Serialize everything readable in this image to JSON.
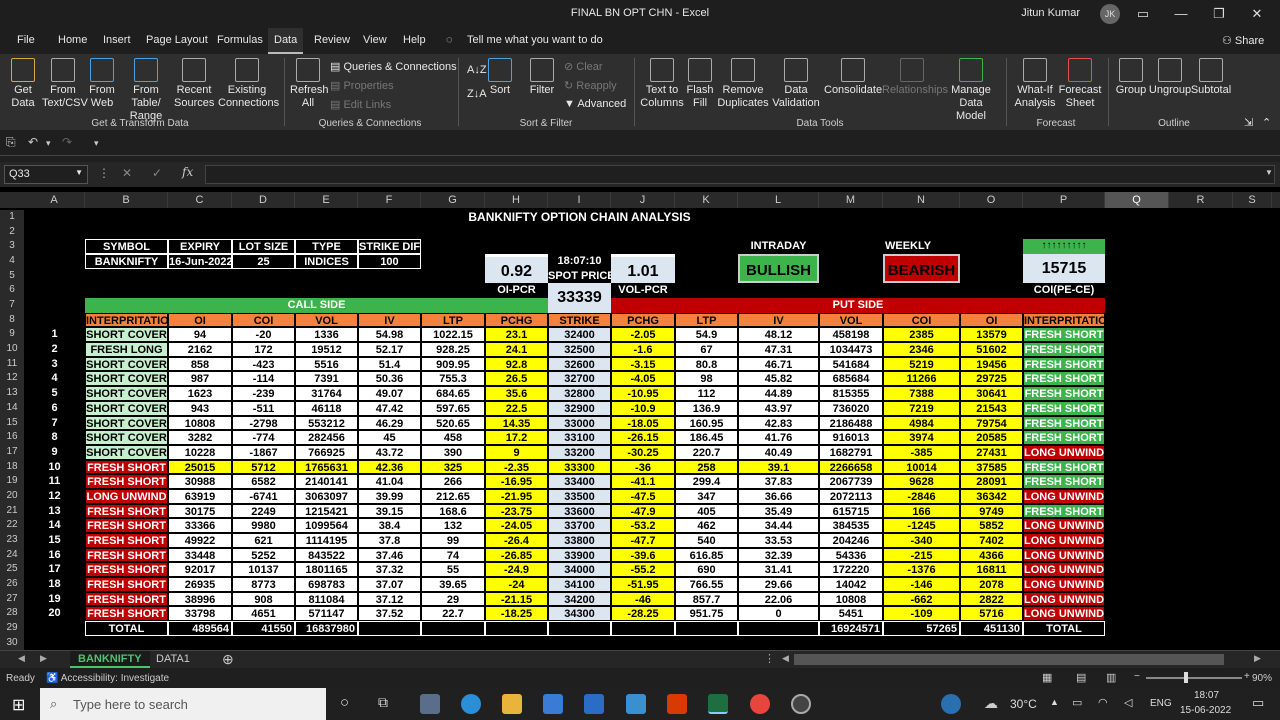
{
  "window": {
    "title": "FINAL BN OPT CHN  -  Excel",
    "user": "Jitun Kumar",
    "avatar": "JK"
  },
  "menu": [
    "File",
    "Home",
    "Insert",
    "Page Layout",
    "Formulas",
    "Data",
    "Review",
    "View",
    "Help"
  ],
  "menu_active": "Data",
  "tell_me": "Tell me what you want to do",
  "share": "Share",
  "ribbon": {
    "get_data": "Get Data",
    "from_text": "From Text/CSV",
    "from_web": "From Web",
    "from_table": "From Table/ Range",
    "recent_sources": "Recent Sources",
    "existing_connections": "Existing Connections",
    "group_get_transform": "Get & Transform Data",
    "refresh_all": "Refresh All",
    "queries_connections": "Queries & Connections",
    "properties": "Properties",
    "edit_links": "Edit Links",
    "group_queries": "Queries & Connections",
    "sort": "Sort",
    "filter": "Filter",
    "clear": "Clear",
    "reapply": "Reapply",
    "advanced": "Advanced",
    "group_sort_filter": "Sort & Filter",
    "text_to_columns": "Text to Columns",
    "flash_fill": "Flash Fill",
    "remove_duplicates": "Remove Duplicates",
    "data_validation": "Data Validation",
    "consolidate": "Consolidate",
    "relationships": "Relationships",
    "manage_data_model": "Manage Data Model",
    "group_data_tools": "Data Tools",
    "what_if": "What-If Analysis",
    "forecast_sheet": "Forecast Sheet",
    "group_forecast": "Forecast",
    "group_btn": "Group",
    "ungroup": "Ungroup",
    "subtotal": "Subtotal",
    "group_outline": "Outline"
  },
  "name_box": "Q33",
  "columns": [
    "A",
    "B",
    "C",
    "D",
    "E",
    "F",
    "G",
    "H",
    "I",
    "J",
    "K",
    "L",
    "M",
    "N",
    "O",
    "P",
    "Q",
    "R",
    "S"
  ],
  "selected_col": "Q",
  "rows": [
    "1",
    "2",
    "3",
    "4",
    "5",
    "6",
    "7",
    "8",
    "9",
    "10",
    "11",
    "12",
    "13",
    "14",
    "15",
    "16",
    "17",
    "18",
    "19",
    "20",
    "21",
    "22",
    "23",
    "24",
    "25",
    "26",
    "27",
    "28",
    "29",
    "30"
  ],
  "sheet": {
    "title": "BANKNIFTY OPTION CHAIN ANALYSIS",
    "info_headers": [
      "SYMBOL",
      "EXPIRY",
      "LOT SIZE",
      "TYPE",
      "STRIKE DIF"
    ],
    "info_values": [
      "BANKNIFTY",
      "16-Jun-2022",
      "25",
      "INDICES",
      "100"
    ],
    "oi_pcr_value": "0.92",
    "oi_pcr_label": "OI-PCR",
    "time": "18:07:10",
    "spot_label": "SPOT PRICE",
    "spot_value": "33339",
    "vol_pcr_value": "1.01",
    "vol_pcr_label": "VOL-PCR",
    "intraday_label": "INTRADAY",
    "intraday_value": "BULLISH",
    "weekly_label": "WEEKLY",
    "weekly_value": "BEARISH",
    "coi_arrows": "↑↑↑↑↑↑↑↑↑",
    "coi_value": "15715",
    "coi_label": "COI(PE-CE)",
    "call_side": "CALL SIDE",
    "put_side": "PUT SIDE",
    "headers": [
      "INTERPRITATION",
      "OI",
      "COI",
      "VOL",
      "IV",
      "LTP",
      "PCHG",
      "STRIKE",
      "PCHG",
      "LTP",
      "IV",
      "VOL",
      "COI",
      "OI",
      "INTERPRITATION"
    ],
    "data": [
      [
        "1",
        "SHORT COVER",
        "94",
        "-20",
        "1336",
        "54.98",
        "1022.15",
        "23.1",
        "32400",
        "-2.05",
        "54.9",
        "48.12",
        "458198",
        "2385",
        "13579",
        "FRESH SHORT"
      ],
      [
        "2",
        "FRESH LONG",
        "2162",
        "172",
        "19512",
        "52.17",
        "928.25",
        "24.1",
        "32500",
        "-1.6",
        "67",
        "47.31",
        "1034473",
        "2346",
        "51602",
        "FRESH SHORT"
      ],
      [
        "3",
        "SHORT COVER",
        "858",
        "-423",
        "5516",
        "51.4",
        "909.95",
        "92.8",
        "32600",
        "-3.15",
        "80.8",
        "46.71",
        "541684",
        "5219",
        "19456",
        "FRESH SHORT"
      ],
      [
        "4",
        "SHORT COVER",
        "987",
        "-114",
        "7391",
        "50.36",
        "755.3",
        "26.5",
        "32700",
        "-4.05",
        "98",
        "45.82",
        "685684",
        "11266",
        "29725",
        "FRESH SHORT"
      ],
      [
        "5",
        "SHORT COVER",
        "1623",
        "-239",
        "31764",
        "49.07",
        "684.65",
        "35.6",
        "32800",
        "-10.95",
        "112",
        "44.89",
        "815355",
        "7388",
        "30641",
        "FRESH SHORT"
      ],
      [
        "6",
        "SHORT COVER",
        "943",
        "-511",
        "46118",
        "47.42",
        "597.65",
        "22.5",
        "32900",
        "-10.9",
        "136.9",
        "43.97",
        "736020",
        "7219",
        "21543",
        "FRESH SHORT"
      ],
      [
        "7",
        "SHORT COVER",
        "10808",
        "-2798",
        "553212",
        "46.29",
        "520.65",
        "14.35",
        "33000",
        "-18.05",
        "160.95",
        "42.83",
        "2186488",
        "4984",
        "79754",
        "FRESH SHORT"
      ],
      [
        "8",
        "SHORT COVER",
        "3282",
        "-774",
        "282456",
        "45",
        "458",
        "17.2",
        "33100",
        "-26.15",
        "186.45",
        "41.76",
        "916013",
        "3974",
        "20585",
        "FRESH SHORT"
      ],
      [
        "9",
        "SHORT COVER",
        "10228",
        "-1867",
        "766925",
        "43.72",
        "390",
        "9",
        "33200",
        "-30.25",
        "220.7",
        "40.49",
        "1682791",
        "-385",
        "27431",
        "LONG UNWIND"
      ],
      [
        "10",
        "FRESH SHORT",
        "25015",
        "5712",
        "1765631",
        "42.36",
        "325",
        "-2.35",
        "33300",
        "-36",
        "258",
        "39.1",
        "2266658",
        "10014",
        "37585",
        "FRESH SHORT"
      ],
      [
        "11",
        "FRESH SHORT",
        "30988",
        "6582",
        "2140141",
        "41.04",
        "266",
        "-16.95",
        "33400",
        "-41.1",
        "299.4",
        "37.83",
        "2067739",
        "9628",
        "28091",
        "FRESH SHORT"
      ],
      [
        "12",
        "LONG UNWIND",
        "63919",
        "-6741",
        "3063097",
        "39.99",
        "212.65",
        "-21.95",
        "33500",
        "-47.5",
        "347",
        "36.66",
        "2072113",
        "-2846",
        "36342",
        "LONG UNWIND"
      ],
      [
        "13",
        "FRESH SHORT",
        "30175",
        "2249",
        "1215421",
        "39.15",
        "168.6",
        "-23.75",
        "33600",
        "-47.9",
        "405",
        "35.49",
        "615715",
        "166",
        "9749",
        "FRESH SHORT"
      ],
      [
        "14",
        "FRESH SHORT",
        "33366",
        "9980",
        "1099564",
        "38.4",
        "132",
        "-24.05",
        "33700",
        "-53.2",
        "462",
        "34.44",
        "384535",
        "-1245",
        "5852",
        "LONG UNWIND"
      ],
      [
        "15",
        "FRESH SHORT",
        "49922",
        "621",
        "1114195",
        "37.8",
        "99",
        "-26.4",
        "33800",
        "-47.7",
        "540",
        "33.53",
        "204246",
        "-340",
        "7402",
        "LONG UNWIND"
      ],
      [
        "16",
        "FRESH SHORT",
        "33448",
        "5252",
        "843522",
        "37.46",
        "74",
        "-26.85",
        "33900",
        "-39.6",
        "616.85",
        "32.39",
        "54336",
        "-215",
        "4366",
        "LONG UNWIND"
      ],
      [
        "17",
        "FRESH SHORT",
        "92017",
        "10137",
        "1801165",
        "37.32",
        "55",
        "-24.9",
        "34000",
        "-55.2",
        "690",
        "31.41",
        "172220",
        "-1376",
        "16811",
        "LONG UNWIND"
      ],
      [
        "18",
        "FRESH SHORT",
        "26935",
        "8773",
        "698783",
        "37.07",
        "39.65",
        "-24",
        "34100",
        "-51.95",
        "766.55",
        "29.66",
        "14042",
        "-146",
        "2078",
        "LONG UNWIND"
      ],
      [
        "19",
        "FRESH SHORT",
        "38996",
        "908",
        "811084",
        "37.12",
        "29",
        "-21.15",
        "34200",
        "-46",
        "857.7",
        "22.06",
        "10808",
        "-662",
        "2822",
        "LONG UNWIND"
      ],
      [
        "20",
        "FRESH SHORT",
        "33798",
        "4651",
        "571147",
        "37.52",
        "22.7",
        "-18.25",
        "34300",
        "-28.25",
        "951.75",
        "0",
        "5451",
        "-109",
        "5716",
        "LONG UNWIND"
      ]
    ],
    "totals": {
      "label": "TOTAL",
      "call_oi": "489564",
      "call_coi": "41550",
      "call_vol": "16837980",
      "put_vol": "16924571",
      "put_coi": "57265",
      "put_oi": "451130",
      "right_label": "TOTAL"
    }
  },
  "sheet_tabs": [
    "BANKNIFTY",
    "DATA1"
  ],
  "active_tab": "BANKNIFTY",
  "status": {
    "ready": "Ready",
    "accessibility": "Accessibility: Investigate",
    "zoom": "90%"
  },
  "taskbar": {
    "search_placeholder": "Type here to search",
    "weather": "30°C",
    "lang": "ENG",
    "time": "18:07",
    "date": "15-06-2022"
  },
  "colors": {
    "green": "#3cb44b",
    "red": "#c00000",
    "yellow": "#ffff00",
    "orange": "#f4813c",
    "light_green": "#c6efce",
    "light_blue": "#dce6f1"
  }
}
